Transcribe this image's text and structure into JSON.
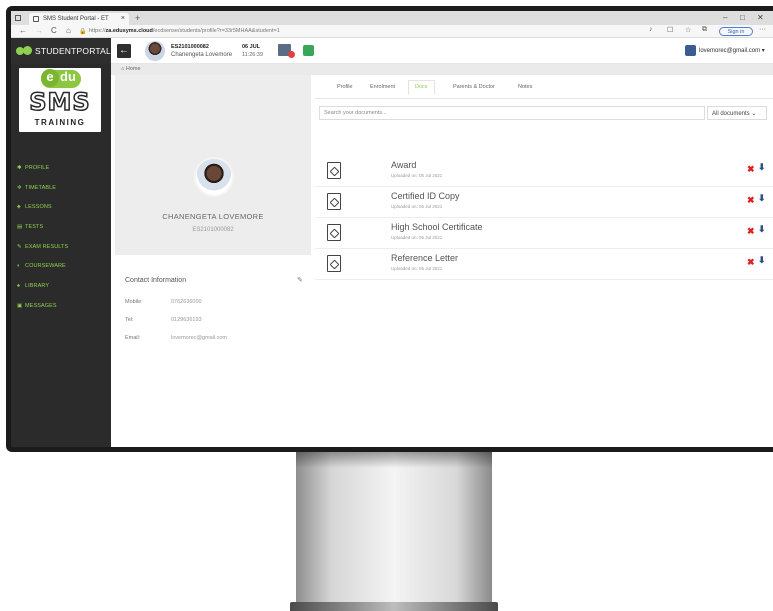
{
  "browser": {
    "tab_title": "SMS Student Portal - ET",
    "tab_close": "×",
    "tab_new": "+",
    "url_prefix": "https://",
    "url_host": "za.edusyms.cloud",
    "url_path": "/ecdsense/students/profile?r=33r5MHAA&student=1",
    "signin": "Sign in",
    "nav": {
      "back": "←",
      "forward": "→",
      "refresh": "C",
      "home": "⌂",
      "lock": "🔒"
    },
    "win": {
      "minimize": "–",
      "maximize": "□",
      "close": "✕",
      "more": "···"
    }
  },
  "app": {
    "brand": "STUDENTPORTAL",
    "back_label": "←",
    "student_id": "ES2101000082",
    "student_name": "Chanengeta Lovemore",
    "date": "06 JUL",
    "time": "11:26:39",
    "user_email": "lovemorec@gmail.com ▾"
  },
  "sidebar": {
    "logo_edu_e": "e",
    "logo_edu_du": "du",
    "logo_sms": "SMS",
    "logo_training": "TRAINING",
    "items": [
      {
        "label": "PROFILE",
        "icon": "home-icon",
        "glyph": "✱"
      },
      {
        "label": "TIMETABLE",
        "icon": "gear-icon",
        "glyph": "✲"
      },
      {
        "label": "LESSONS",
        "icon": "group-icon",
        "glyph": "♣"
      },
      {
        "label": "TESTS",
        "icon": "list-icon",
        "glyph": "▤"
      },
      {
        "label": "EXAM RESULTS",
        "icon": "edit-icon",
        "glyph": "✎"
      },
      {
        "label": "COURSEWARE",
        "icon": "cloud-icon",
        "glyph": "◐"
      },
      {
        "label": "LIBRARY",
        "icon": "basket-icon",
        "glyph": "♠"
      },
      {
        "label": "MESSAGES",
        "icon": "message-icon",
        "glyph": "▣"
      }
    ]
  },
  "breadcrumb": {
    "glyph": "⌂",
    "label": "Home"
  },
  "profile": {
    "name": "CHANENGETA LOVEMORE",
    "id": "ES2101000082",
    "contact_title": "Contact Information",
    "edit_glyph": "✎",
    "fields": [
      {
        "label": "Mobile:",
        "value": "0762636000"
      },
      {
        "label": "Tel:",
        "value": "0129636193"
      },
      {
        "label": "Email:",
        "value": "lovemorec@gmail.com"
      }
    ]
  },
  "docs": {
    "tabs": [
      "Profile",
      "Enrolment",
      "Docs",
      "Parents & Doctor",
      "Notes"
    ],
    "active_tab": "Docs",
    "search_placeholder": "Search your documents...",
    "filter": "All documents ⌄",
    "delete_glyph": "✖",
    "download_glyph": "⬇",
    "items": [
      {
        "name": "Award",
        "uploaded": "Uploaded on: 05 Jul 2021"
      },
      {
        "name": "Certified ID Copy",
        "uploaded": "Uploaded on: 05 Jul 2021"
      },
      {
        "name": "High School Certificate",
        "uploaded": "Uploaded on: 05 Jul 2021"
      },
      {
        "name": "Reference Letter",
        "uploaded": "Uploaded on: 05 Jul 2021"
      }
    ]
  },
  "colors": {
    "accent": "#8fd14f",
    "sidebar_bg": "#2b2b2b",
    "delete": "#e02020",
    "download": "#2f4f8a"
  }
}
